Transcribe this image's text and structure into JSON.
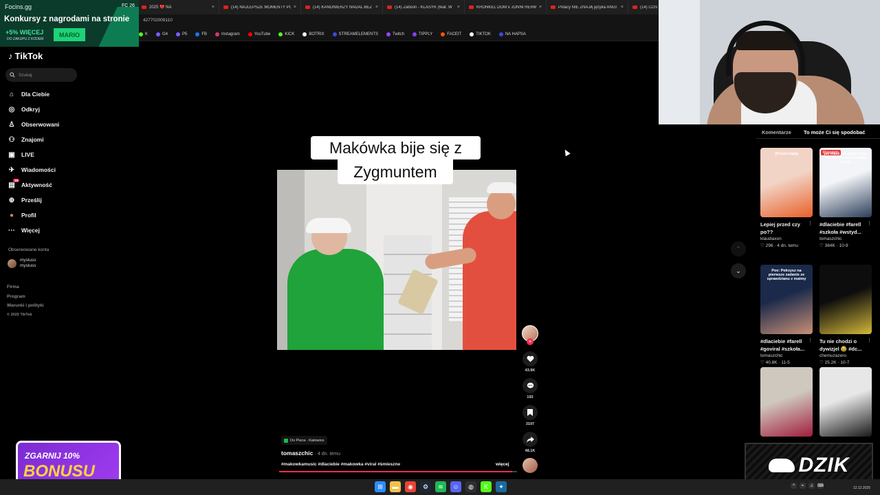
{
  "browser": {
    "tabs": [
      {
        "label": "2025 💔 NA"
      },
      {
        "label": "(14) NAJLEPSZE MOMENTY PO"
      },
      {
        "label": "(14) KANONIERZY NADAL BEZ"
      },
      {
        "label": "(14) Żabson - KLASYK (feat. W"
      },
      {
        "label": "KRONKEL DOM x JONNI HERM"
      },
      {
        "label": "Polacy NIE ZNAJĄ języka ANGI"
      },
      {
        "label": "(14) COŚ JEST NIE TAK | TO JEST"
      }
    ],
    "tab_close": "×",
    "url": "427702009110",
    "bookmarks": [
      {
        "label": "K",
        "color": "#53fc18"
      },
      {
        "label": "G4",
        "color": "#7b5cff"
      },
      {
        "label": "P5",
        "color": "#7b5cff"
      },
      {
        "label": "FB",
        "color": "#1877f2"
      },
      {
        "label": "Instagram",
        "color": "#e1306c"
      },
      {
        "label": "YouTube",
        "color": "#ff0000"
      },
      {
        "label": "KICK",
        "color": "#53fc18"
      },
      {
        "label": "BOTRIX",
        "color": "#ffffff"
      },
      {
        "label": "STREAMELEMENTS",
        "color": "#3b49df"
      },
      {
        "label": "Twitch",
        "color": "#9146ff"
      },
      {
        "label": "TIPPLY",
        "color": "#8a3ffc"
      },
      {
        "label": "FACEIT",
        "color": "#ff5500"
      },
      {
        "label": "TIKTOK",
        "color": "#ffffff"
      },
      {
        "label": "NA HAPSA",
        "color": "#3b49df"
      }
    ]
  },
  "promo": {
    "site": "Focins.gg",
    "status": "FC 26",
    "headline": "Konkursy z nagrodami na stronie",
    "bonus": "+5% WIĘCEJ",
    "sub": "DO ZAKUPU Z KODEM",
    "code": "MARIO"
  },
  "sidebar": {
    "logo": "TikTok",
    "search_placeholder": "Szukaj",
    "items": [
      {
        "label": "Dla Ciebie",
        "icon": "home-icon",
        "glyph": "⌂"
      },
      {
        "label": "Odkryj",
        "icon": "compass-icon",
        "glyph": "◎"
      },
      {
        "label": "Obserwowani",
        "icon": "following-icon",
        "glyph": "♙"
      },
      {
        "label": "Znajomi",
        "icon": "friends-icon",
        "glyph": "⚇"
      },
      {
        "label": "LIVE",
        "icon": "live-icon",
        "glyph": "▣"
      },
      {
        "label": "Wiadomości",
        "icon": "messages-icon",
        "glyph": "✈"
      },
      {
        "label": "Aktywność",
        "icon": "activity-icon",
        "glyph": "▤",
        "badge": "19"
      },
      {
        "label": "Prześlij",
        "icon": "upload-icon",
        "glyph": "⊕"
      },
      {
        "label": "Profil",
        "icon": "profile-avatar",
        "glyph": "●"
      },
      {
        "label": "Więcej",
        "icon": "more-icon",
        "glyph": "···"
      }
    ],
    "followed_header": "Obserwowane konta",
    "followed": {
      "name": "mysluss",
      "handle": "mysluss"
    },
    "footer": [
      "Firma",
      "Program",
      "Warunki i polityki",
      "© 2025 TikTok"
    ]
  },
  "video": {
    "caption_line1": "Makówka bije się z",
    "caption_line2": "Zygmuntem",
    "location": "Do Pieca - Katowice",
    "author": "tomaszchic",
    "ago": "· 4 dn. temu",
    "hashtags": "#makowkamusic #dlaciebie #makowka #viral #śmieszne",
    "more": "więcej",
    "progress": 0.98,
    "likes": "43.9K",
    "comments": "193",
    "saves": "3197",
    "shares": "48.1K"
  },
  "right_panel": {
    "tabs": [
      "Komentarze",
      "To może Ci się spodobać"
    ],
    "active_tab": 1,
    "cards": [
      {
        "title": "Lepiej przed czy po??",
        "author": "klaudiaxxn",
        "stats": "♡ 296 · 4 dn. temu",
        "overlay": "(Przed ciążą)",
        "badge": "",
        "colors": [
          "#f2d4c6",
          "#e8602a"
        ]
      },
      {
        "title": "#dlaciebie #farell #szkoła #wstyd...",
        "author": "tomaszchic",
        "stats": "♡ 384K · 10-9",
        "overlay": "juz masz raz masz sakej wbiles do randomowej klasy",
        "badge": "Przypięto",
        "colors": [
          "#f2f4f7",
          "#2c3e5a"
        ]
      },
      {
        "title": "#dlaciebie #farell #goviral #szkoła...",
        "author": "tomaszchic",
        "stats": "♡ 40.8K · 11-5",
        "overlay": "Pov: Pełrzysz na pierwsze zadanie ze sprawdzianu z matmy",
        "badge": "",
        "colors": [
          "#1b2a4a",
          "#c98f77"
        ]
      },
      {
        "title": "Tu nie chodzi o dywizjel 😂 #dc...",
        "author": "chemuzazero",
        "stats": "♡ 25.2K · 10-7",
        "overlay": "",
        "badge": "",
        "colors": [
          "#0d0d0d",
          "#d4b83a"
        ]
      },
      {
        "title": "",
        "author": "",
        "stats": "",
        "overlay": "",
        "badge": "",
        "colors": [
          "#cfc8be",
          "#a01e3c"
        ]
      },
      {
        "title": "",
        "author": "",
        "stats": "",
        "overlay": "",
        "badge": "",
        "colors": [
          "#e7e7e7",
          "#1a1a1a"
        ]
      }
    ]
  },
  "overlays": {
    "bonus_line1": "ZGARNIJ 10%",
    "bonus_line2": "BONUSU",
    "dzik": "DZIK"
  },
  "taskbar": {
    "date": "12.12.2025",
    "apps": [
      {
        "name": "windows-start-icon",
        "glyph": "⊞",
        "color": "#2b8cff"
      },
      {
        "name": "explorer-icon",
        "glyph": "▬",
        "color": "#f2c14e"
      },
      {
        "name": "chrome-icon",
        "glyph": "◉",
        "color": "#e94235"
      },
      {
        "name": "steam-icon",
        "glyph": "⚙",
        "color": "#1b2838"
      },
      {
        "name": "spotify-icon",
        "glyph": "≋",
        "color": "#1db954"
      },
      {
        "name": "discord-icon",
        "glyph": "☺",
        "color": "#5865f2"
      },
      {
        "name": "obs-icon",
        "glyph": "◍",
        "color": "#302e31"
      },
      {
        "name": "kick-icon",
        "glyph": "K",
        "color": "#53fc18"
      },
      {
        "name": "steam2-icon",
        "glyph": "✦",
        "color": "#1b6aa0"
      }
    ]
  }
}
